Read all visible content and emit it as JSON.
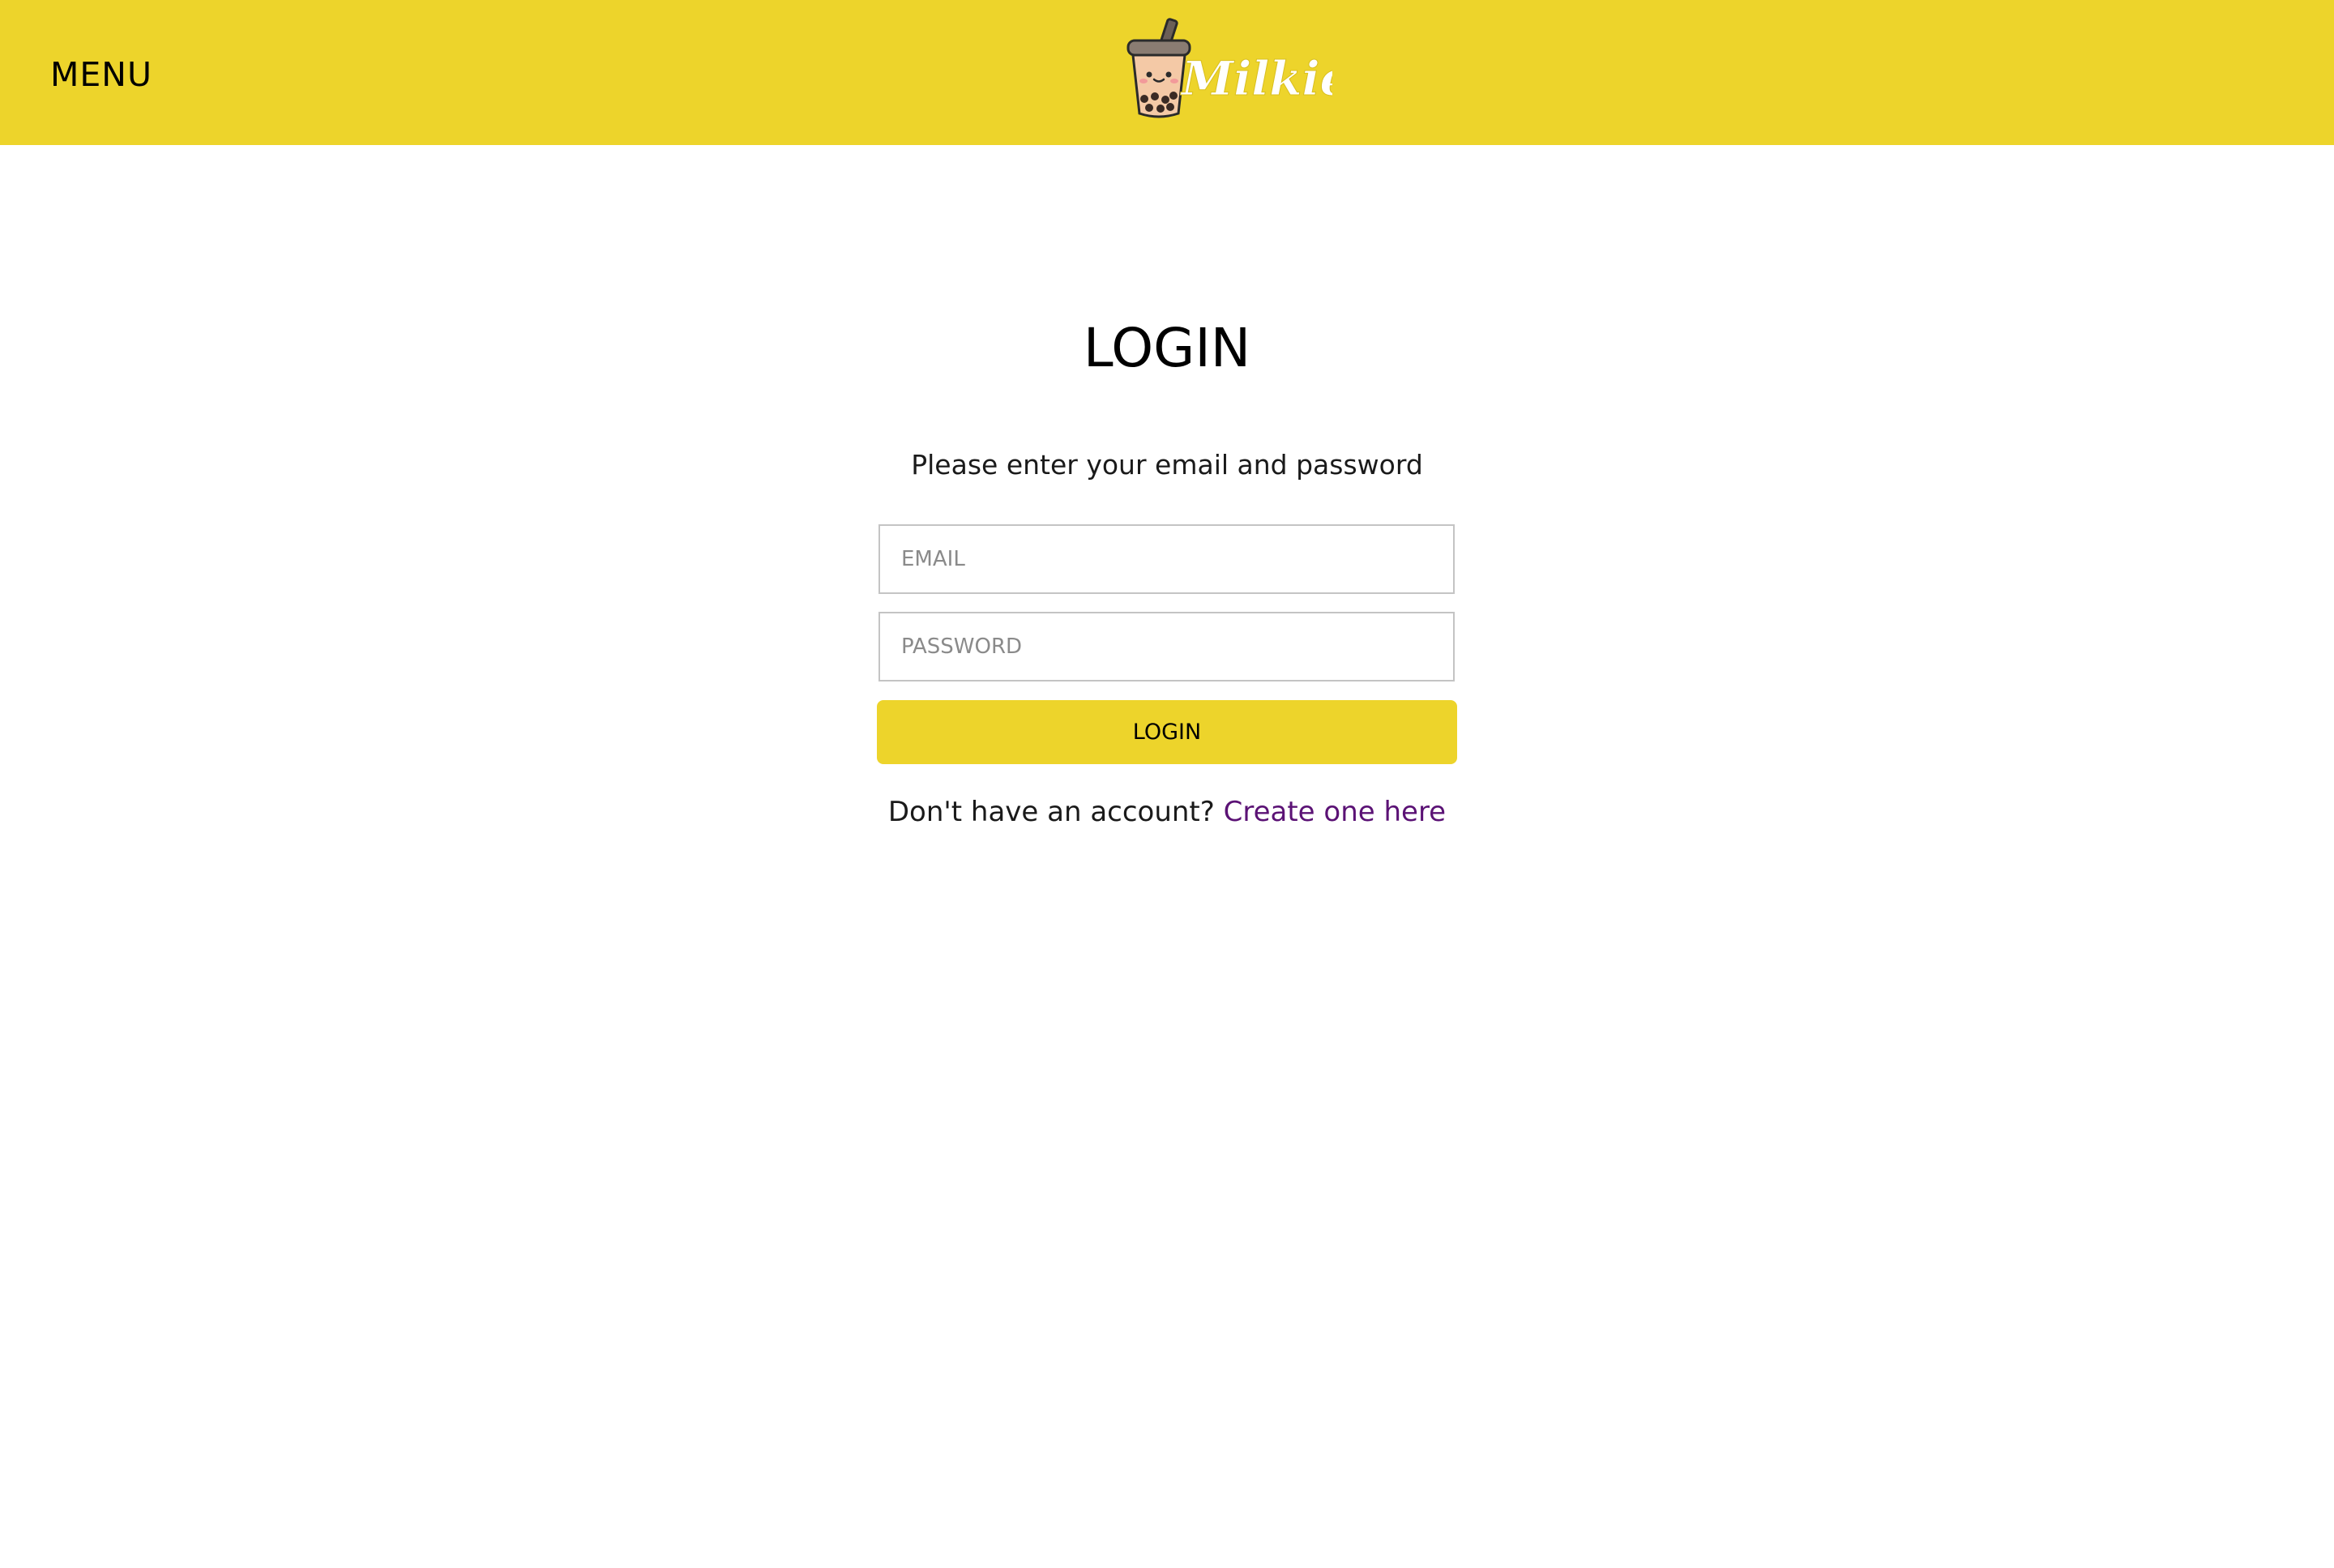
{
  "header": {
    "menu_label": "MENU",
    "brand_name": "Milkies",
    "background_color": "#edd42b",
    "logo_icon": "bubble-tea-cup-icon"
  },
  "main": {
    "title": "LOGIN",
    "instruction": "Please enter your email and password",
    "email_placeholder": "EMAIL",
    "email_value": "",
    "password_placeholder": "PASSWORD",
    "password_value": "",
    "login_button_label": "LOGIN",
    "signup_prompt": "Don't have an account?",
    "signup_link_label": "Create one here",
    "link_color": "#5b1275"
  }
}
